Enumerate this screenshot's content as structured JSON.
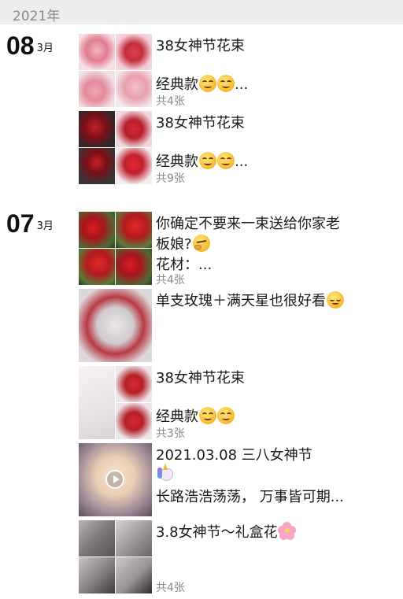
{
  "year_header": "2021年",
  "dates": [
    {
      "day": "08",
      "month": "3月"
    },
    {
      "day": "07",
      "month": "3月"
    }
  ],
  "posts": [
    {
      "line1": "38女神节花束",
      "line2": "经典款",
      "line2_suffix": "...",
      "count": "共4张",
      "emoji_line2": [
        "smile-icon",
        "smile-icon"
      ]
    },
    {
      "line1": "38女神节花束",
      "line2": "经典款",
      "line2_suffix": "...",
      "count": "共9张",
      "emoji_line2": [
        "smile-icon",
        "smile-icon"
      ]
    },
    {
      "line1": "你确定不要来一束送给你家老",
      "line2": "板娘?",
      "line3": "花材：...",
      "count": "共4张",
      "emoji_line2": [
        "thinking-face-icon"
      ]
    },
    {
      "line1": "单支玫瑰＋满天星也很好看",
      "emoji_line1": [
        "relieved-face-icon"
      ]
    },
    {
      "line1": "38女神节花束",
      "line2": "经典款",
      "count": "共3张",
      "emoji_line2": [
        "smile-icon",
        "smile-icon"
      ]
    },
    {
      "line1": "2021.03.08 三八女神节",
      "line3": "长路浩浩荡荡，  万事皆可期...",
      "emoji_line2": [
        "unicorn-icon"
      ],
      "video": true
    },
    {
      "line1": "3.8女神节～礼盒花",
      "count": "共4张",
      "emoji_line1": [
        "cherry-blossom-icon"
      ]
    }
  ]
}
